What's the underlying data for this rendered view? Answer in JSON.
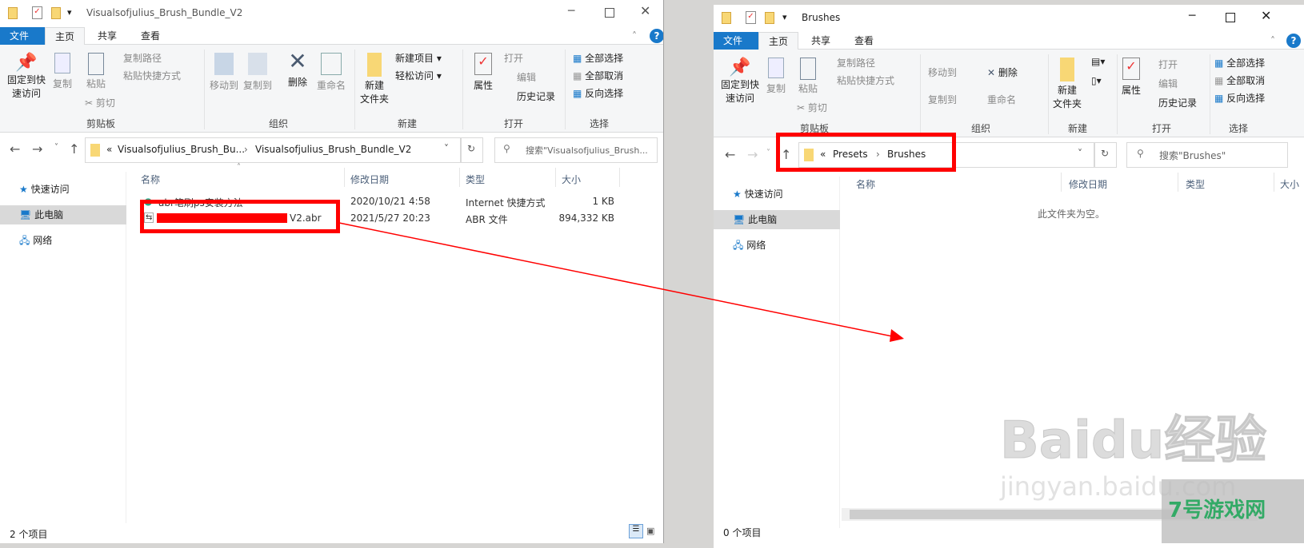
{
  "left_window": {
    "title": "Visualsofjulius_Brush_Bundle_V2",
    "tabs": [
      "文件",
      "主页",
      "共享",
      "查看"
    ],
    "ribbon": {
      "pin": "固定到快\n速访问",
      "copy": "复制",
      "paste": "粘贴",
      "copy_path": "复制路径",
      "paste_shortcut": "粘贴快捷方式",
      "cut": "剪切",
      "clipboard": "剪贴板",
      "move_to": "移动到",
      "copy_to": "复制到",
      "delete": "删除",
      "rename": "重命名",
      "organize": "组织",
      "new_folder": "新建\n文件夹",
      "new_item": "新建项目",
      "easy_access": "轻松访问",
      "new": "新建",
      "properties": "属性",
      "open": "打开",
      "edit": "编辑",
      "history": "历史记录",
      "open_group": "打开",
      "select_all": "全部选择",
      "select_none": "全部取消",
      "invert": "反向选择",
      "select": "选择"
    },
    "address": {
      "crumbs": [
        "Visualsofjulius_Brush_Bu...",
        "Visualsofjulius_Brush_Bundle_V2"
      ],
      "search_placeholder": "搜索\"Visualsofjulius_Brush..."
    },
    "nav": [
      "快速访问",
      "此电脑",
      "网络"
    ],
    "columns": [
      "名称",
      "修改日期",
      "类型",
      "大小"
    ],
    "files": [
      {
        "name": "abr笔刷ps安装方法",
        "date": "2020/10/21 4:58",
        "type": "Internet 快捷方式",
        "size": "1 KB"
      },
      {
        "name": "V2.abr",
        "date": "2021/5/27 20:23",
        "type": "ABR 文件",
        "size": "894,332 KB"
      }
    ],
    "status": "2 个项目"
  },
  "right_window": {
    "title": "Brushes",
    "tabs": [
      "文件",
      "主页",
      "共享",
      "查看"
    ],
    "address": {
      "crumbs": [
        "Presets",
        "Brushes"
      ],
      "search_placeholder": "搜索\"Brushes\""
    },
    "nav": [
      "快速访问",
      "此电脑",
      "网络"
    ],
    "columns": [
      "名称",
      "修改日期",
      "类型",
      "大小"
    ],
    "empty_message": "此文件夹为空。",
    "status": "0 个项目"
  },
  "watermarks": {
    "baidu": "Baidu经验",
    "baidu_url": "jingyan.baidu.com",
    "corner": "7号游戏网"
  },
  "colors": {
    "accent": "#1979ca",
    "annotation": "#ff0000"
  }
}
